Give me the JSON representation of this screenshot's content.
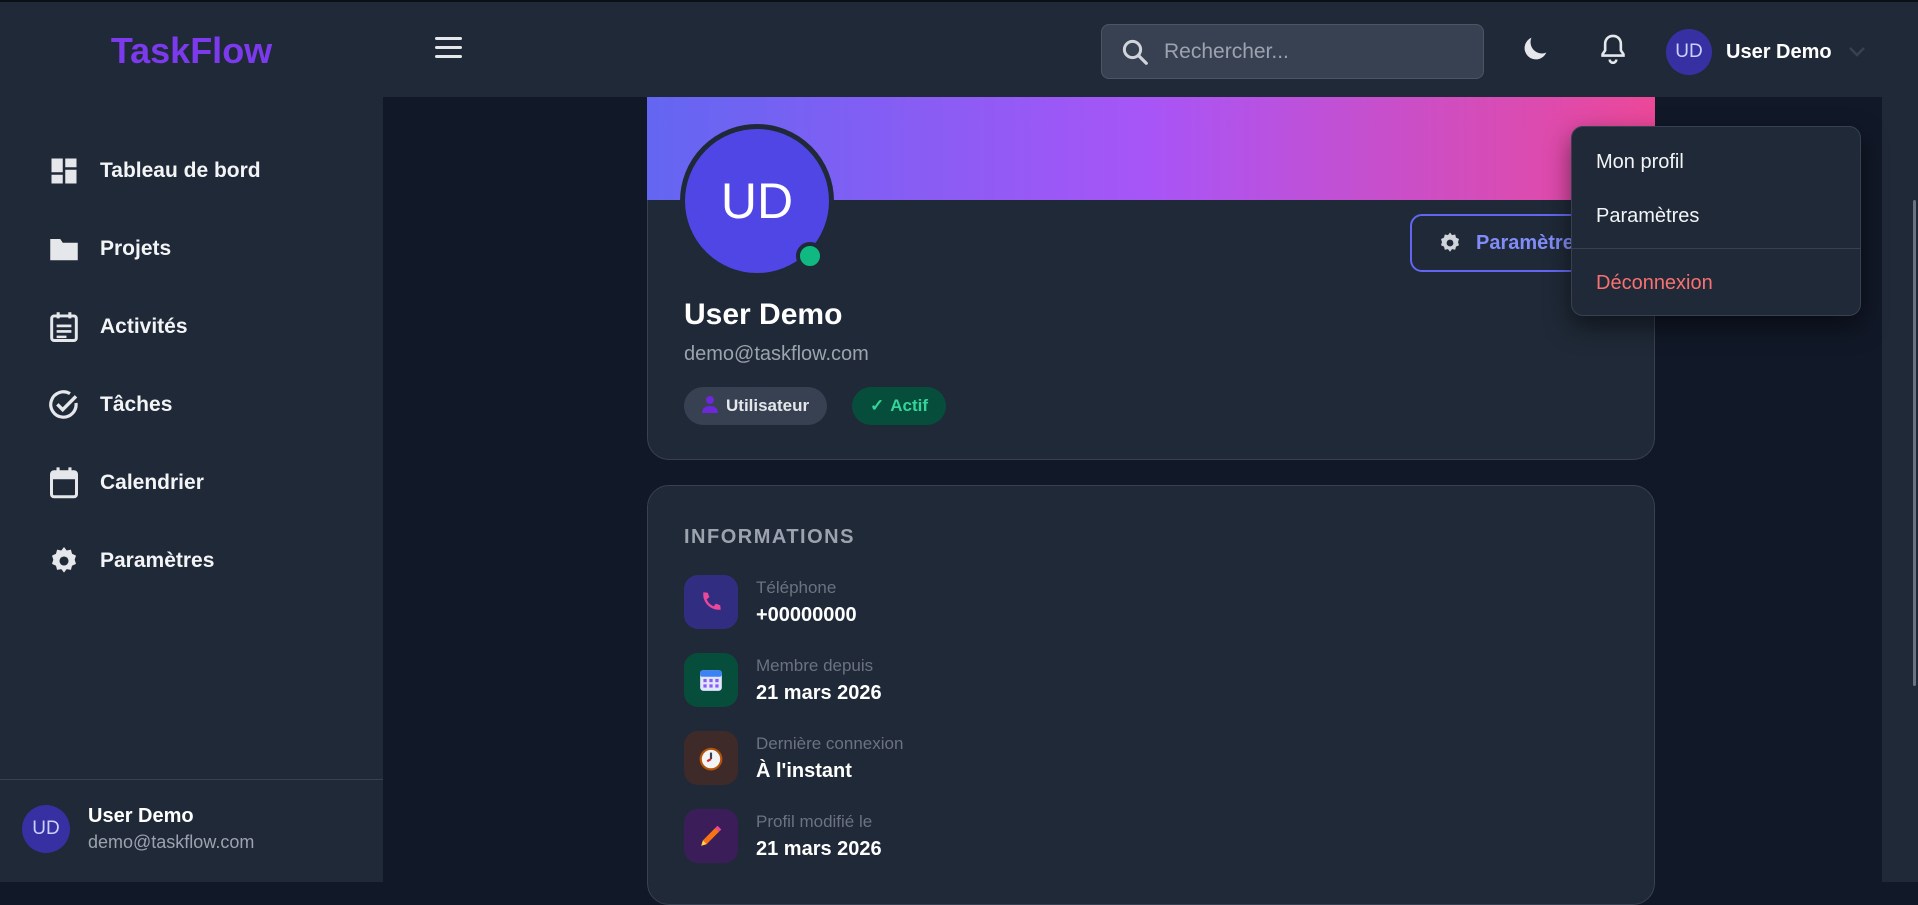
{
  "brand": {
    "name": "TaskFlow",
    "color": "#7c3aed"
  },
  "header": {
    "search_placeholder": "Rechercher...",
    "user_initials": "UD",
    "user_name": "User Demo"
  },
  "sidebar": {
    "items": [
      {
        "label": "Tableau de bord",
        "icon": "dashboard-icon"
      },
      {
        "label": "Projets",
        "icon": "folder-icon"
      },
      {
        "label": "Activités",
        "icon": "activity-icon"
      },
      {
        "label": "Tâches",
        "icon": "task-check-icon"
      },
      {
        "label": "Calendrier",
        "icon": "calendar-icon"
      },
      {
        "label": "Paramètres",
        "icon": "gear-icon"
      }
    ],
    "user": {
      "initials": "UD",
      "name": "User Demo",
      "email": "demo@taskflow.com"
    }
  },
  "profile": {
    "initials": "UD",
    "name": "User Demo",
    "email": "demo@taskflow.com",
    "settings_button": "Paramètres",
    "badges": {
      "role": "Utilisateur",
      "status": "Actif",
      "status_check": "✓"
    },
    "status_color": "#10b981"
  },
  "info": {
    "title": "INFORMATIONS",
    "rows": [
      {
        "label": "Téléphone",
        "value": "+00000000",
        "icon": "phone-icon"
      },
      {
        "label": "Membre depuis",
        "value": "21 mars 2026",
        "icon": "calendar-emoji-icon"
      },
      {
        "label": "Dernière connexion",
        "value": "À l'instant",
        "icon": "clock-icon"
      },
      {
        "label": "Profil modifié le",
        "value": "21 mars 2026",
        "icon": "pencil-icon"
      }
    ]
  },
  "dropdown": {
    "items": [
      "Mon profil",
      "Paramètres"
    ],
    "logout": "Déconnexion",
    "logout_color": "#f87171"
  }
}
